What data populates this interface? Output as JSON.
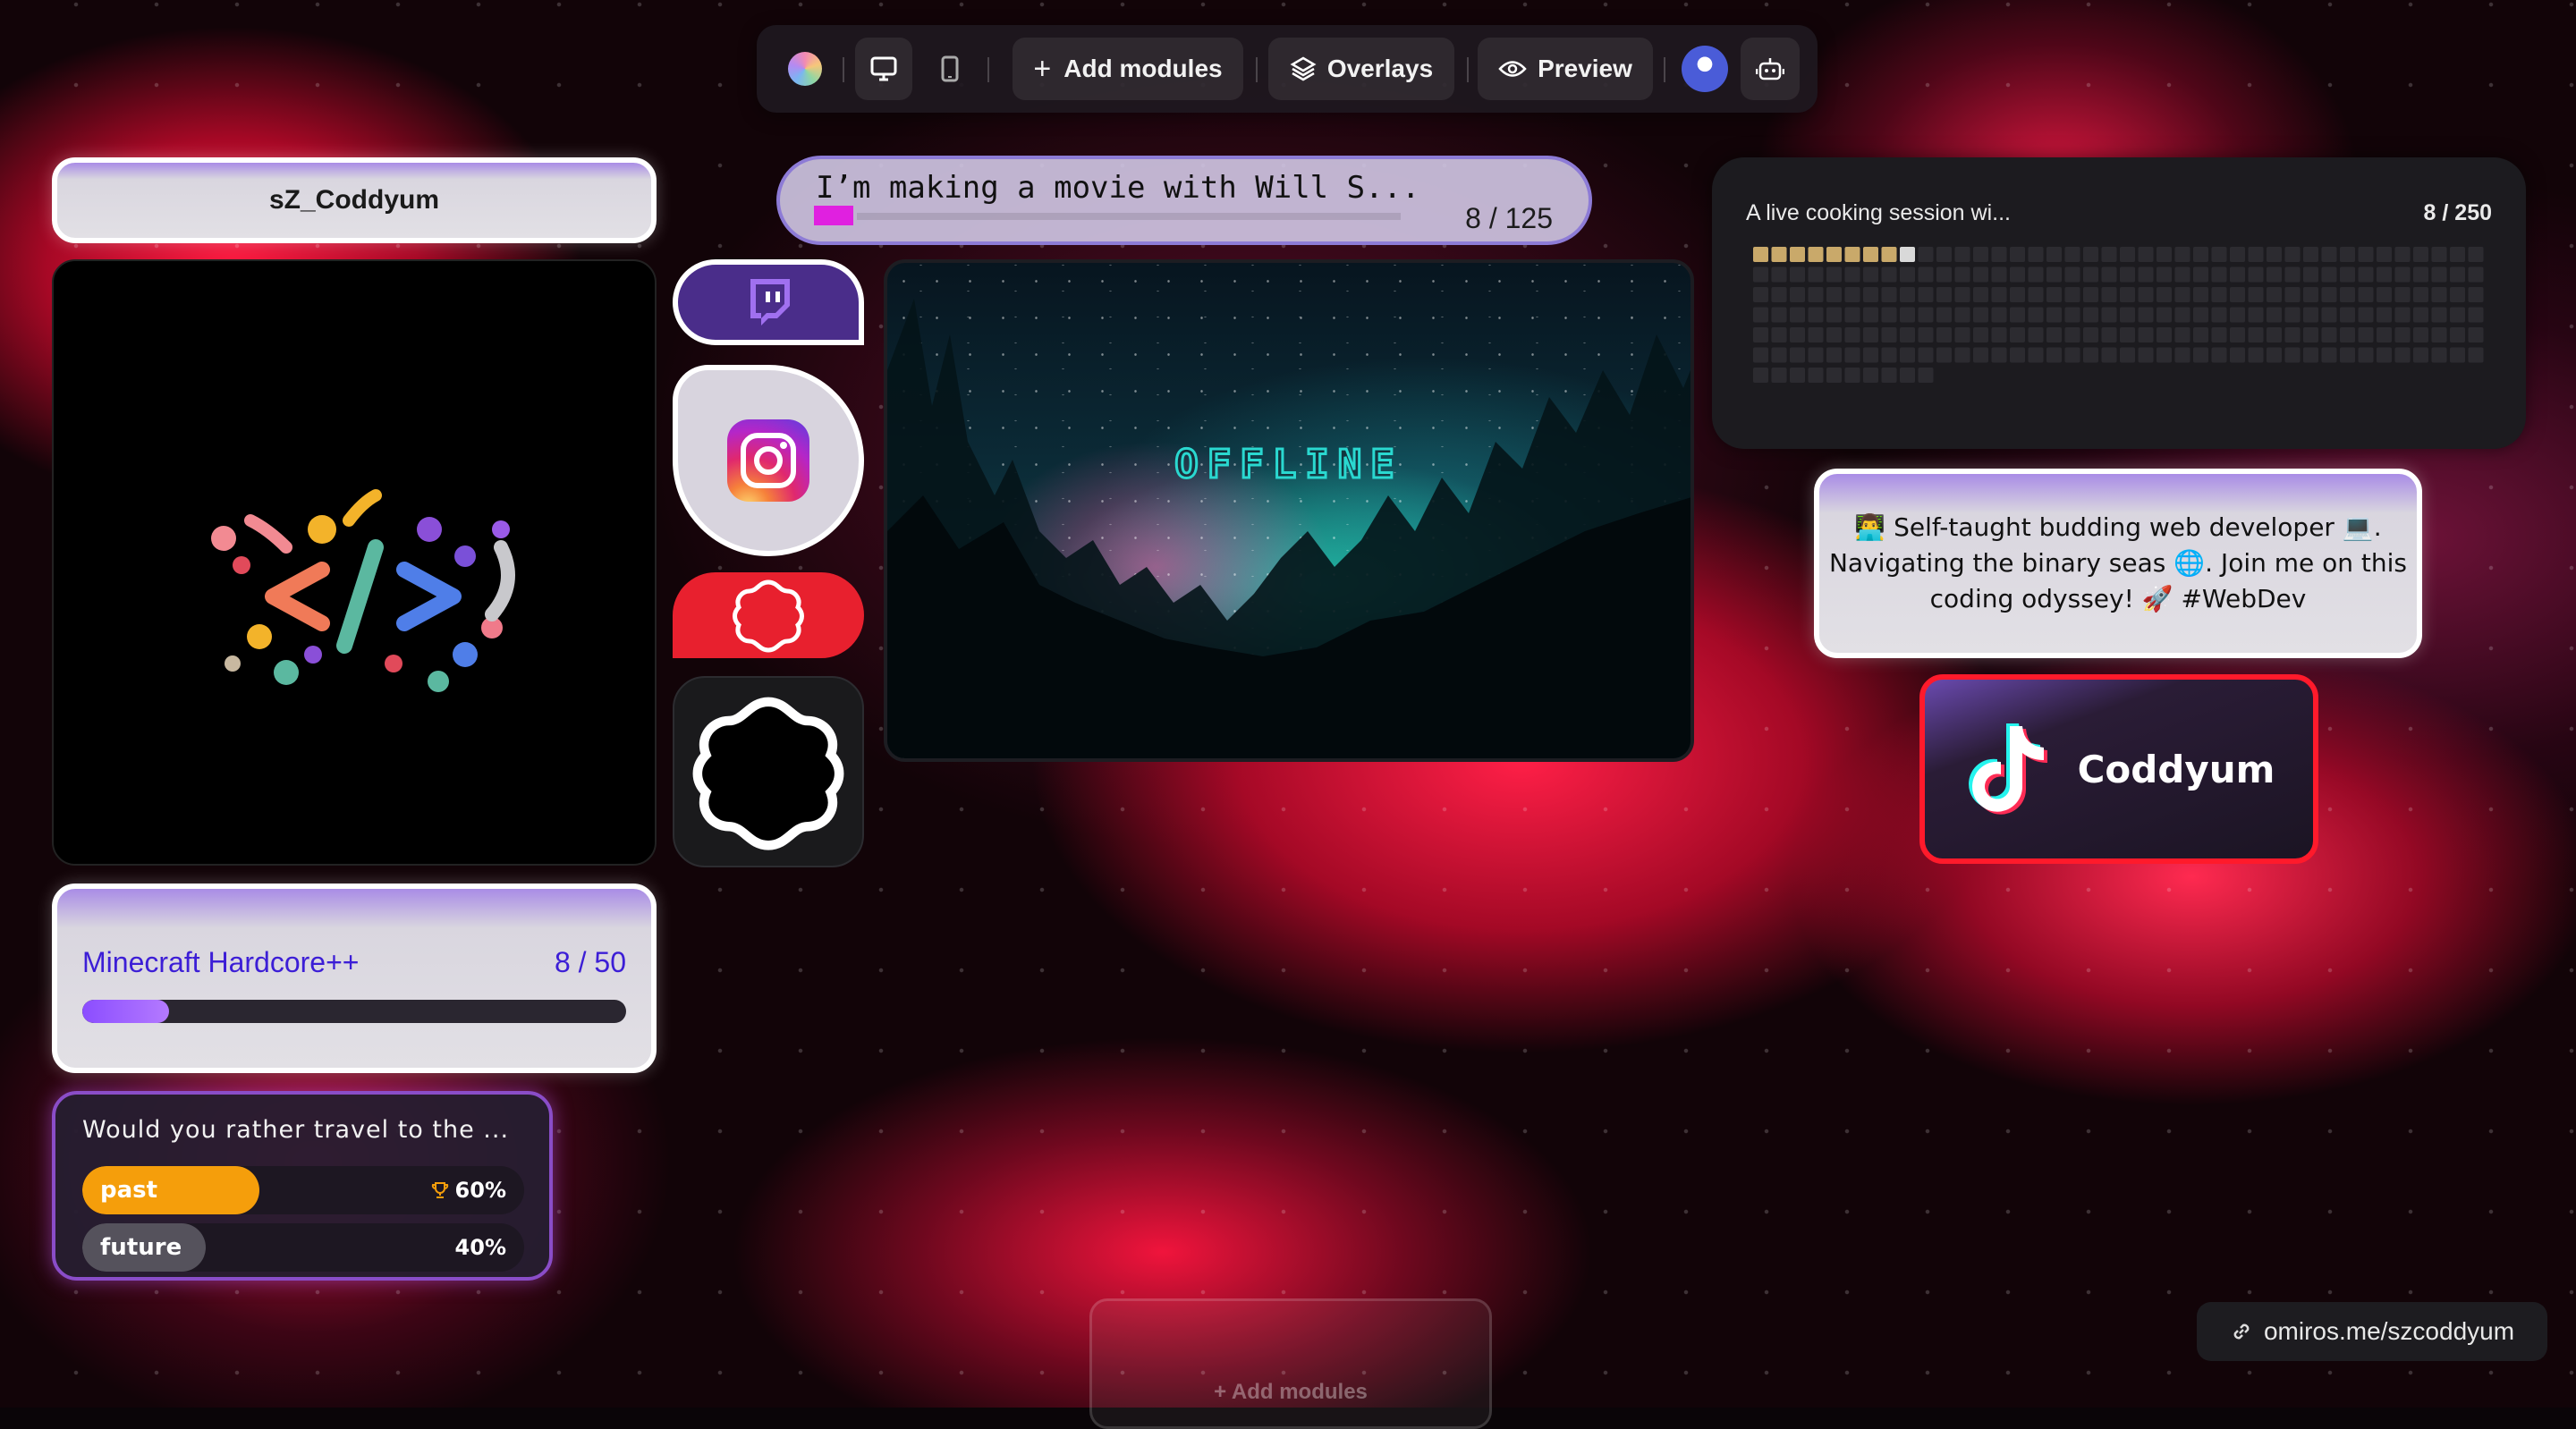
{
  "toolbar": {
    "add_modules_label": "Add modules",
    "overlays_label": "Overlays",
    "preview_label": "Preview"
  },
  "profile": {
    "username": "sZ_Coddyum"
  },
  "goal": {
    "title": "Minecraft Hardcore++",
    "count": "8 / 50",
    "progress": 0.16,
    "fill_color": "#8b4dff"
  },
  "poll": {
    "question": "Would you rather travel to the ...",
    "options": [
      {
        "label": "past",
        "percent": "60%",
        "value": 0.6,
        "color": "#f59e0b",
        "winner": true
      },
      {
        "label": "future",
        "percent": "40%",
        "value": 0.4,
        "color": "#55525c",
        "winner": false
      }
    ]
  },
  "ticker": {
    "text": "I’m making a movie with Will S...",
    "count": "8 / 125"
  },
  "video": {
    "status_text": "OFFLINE"
  },
  "pixel_goal": {
    "title": "A live cooking session wi...",
    "count": "8 / 250",
    "filled": 8,
    "total": 250,
    "filled_color": "#c9a96a",
    "next_color": "#d9d9d9",
    "empty_color": "#2c2b30"
  },
  "bio": {
    "text": "👨‍💻 Self-taught budding web developer 💻. Navigating the binary seas 🌐. Join me on this coding odyssey! 🚀 #WebDev"
  },
  "tiktok": {
    "name": "Coddyum"
  },
  "link": {
    "url": "omiros.me/szcoddyum"
  },
  "ghost": {
    "label": "+ Add modules"
  },
  "colors": {
    "accent": "#3c1ed6",
    "twitch": "#4a2d8a",
    "tiktok_border": "#ff1a2b"
  }
}
